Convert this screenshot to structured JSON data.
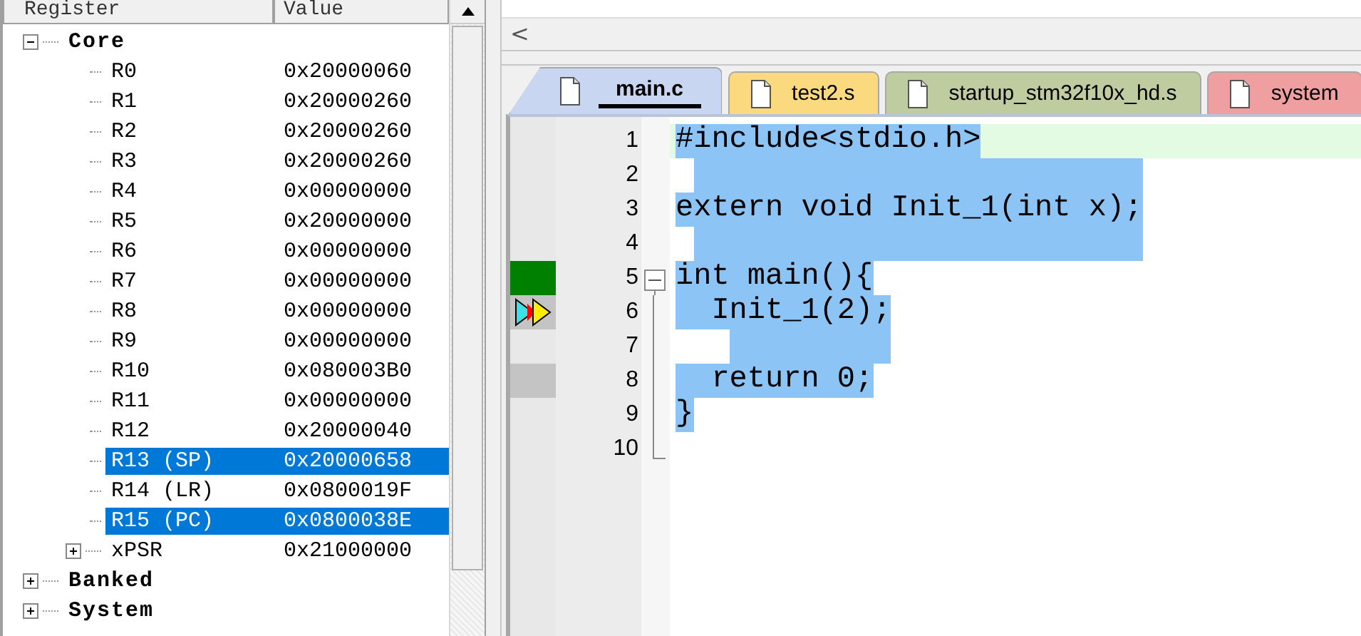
{
  "registers": {
    "columns": [
      "Register",
      "Value"
    ],
    "groups": [
      {
        "name": "Core",
        "expanded": true,
        "selected": false,
        "children": [
          {
            "name": "R0",
            "value": "0x20000060",
            "selected": false
          },
          {
            "name": "R1",
            "value": "0x20000260",
            "selected": false
          },
          {
            "name": "R2",
            "value": "0x20000260",
            "selected": false
          },
          {
            "name": "R3",
            "value": "0x20000260",
            "selected": false
          },
          {
            "name": "R4",
            "value": "0x00000000",
            "selected": false
          },
          {
            "name": "R5",
            "value": "0x20000000",
            "selected": false
          },
          {
            "name": "R6",
            "value": "0x00000000",
            "selected": false
          },
          {
            "name": "R7",
            "value": "0x00000000",
            "selected": false
          },
          {
            "name": "R8",
            "value": "0x00000000",
            "selected": false
          },
          {
            "name": "R9",
            "value": "0x00000000",
            "selected": false
          },
          {
            "name": "R10",
            "value": "0x080003B0",
            "selected": false
          },
          {
            "name": "R11",
            "value": "0x00000000",
            "selected": false
          },
          {
            "name": "R12",
            "value": "0x20000040",
            "selected": false
          },
          {
            "name": "R13 (SP)",
            "value": "0x20000658",
            "selected": true
          },
          {
            "name": "R14 (LR)",
            "value": "0x0800019F",
            "selected": false
          },
          {
            "name": "R15 (PC)",
            "value": "0x0800038E",
            "selected": true
          },
          {
            "name": "xPSR",
            "value": "0x21000000",
            "selected": false,
            "expanded": false
          }
        ]
      },
      {
        "name": "Banked",
        "expanded": false,
        "selected": false
      },
      {
        "name": "System",
        "expanded": false,
        "selected": false
      }
    ]
  },
  "editor": {
    "scroll_left": "<",
    "tabs": [
      {
        "label": "main.c",
        "selected": true,
        "color": "#c9d6f2"
      },
      {
        "label": "test2.s",
        "selected": false,
        "color": "#fbd97e"
      },
      {
        "label": "startup_stm32f10x_hd.s",
        "selected": false,
        "color": "#bfcc9f"
      },
      {
        "label": "system",
        "selected": false,
        "color": "#ef9f9f"
      }
    ],
    "lines": [
      {
        "number": "1",
        "text": "#include<stdio.h>",
        "selected": true,
        "current": true
      },
      {
        "number": "2",
        "selected": true,
        "current": false
      },
      {
        "number": "3",
        "text": "extern void Init_1(int x);",
        "selected": true,
        "current": false
      },
      {
        "number": "4",
        "selected": true,
        "current": false
      },
      {
        "number": "5",
        "text": "int main(){",
        "selected": true,
        "current": false,
        "marker": {
          "kind": "executed"
        },
        "fold": {
          "kind": "start"
        }
      },
      {
        "number": "6",
        "text": "  Init_1(2);",
        "selected": true,
        "current": false,
        "marker": {
          "kind": "pointer"
        },
        "fold": {
          "kind": "inner"
        }
      },
      {
        "number": "7",
        "selected": true,
        "current": false,
        "fold": {
          "kind": "inner"
        }
      },
      {
        "number": "8",
        "text": "  return 0;",
        "selected": true,
        "current": false,
        "marker": {
          "kind": "code"
        },
        "fold": {
          "kind": "inner"
        }
      },
      {
        "number": "9",
        "text": "}",
        "selected": true,
        "current": false,
        "fold": {
          "kind": "inner"
        }
      },
      {
        "number": "10",
        "selected": false,
        "current": false,
        "fold": {
          "kind": "end"
        }
      }
    ]
  }
}
